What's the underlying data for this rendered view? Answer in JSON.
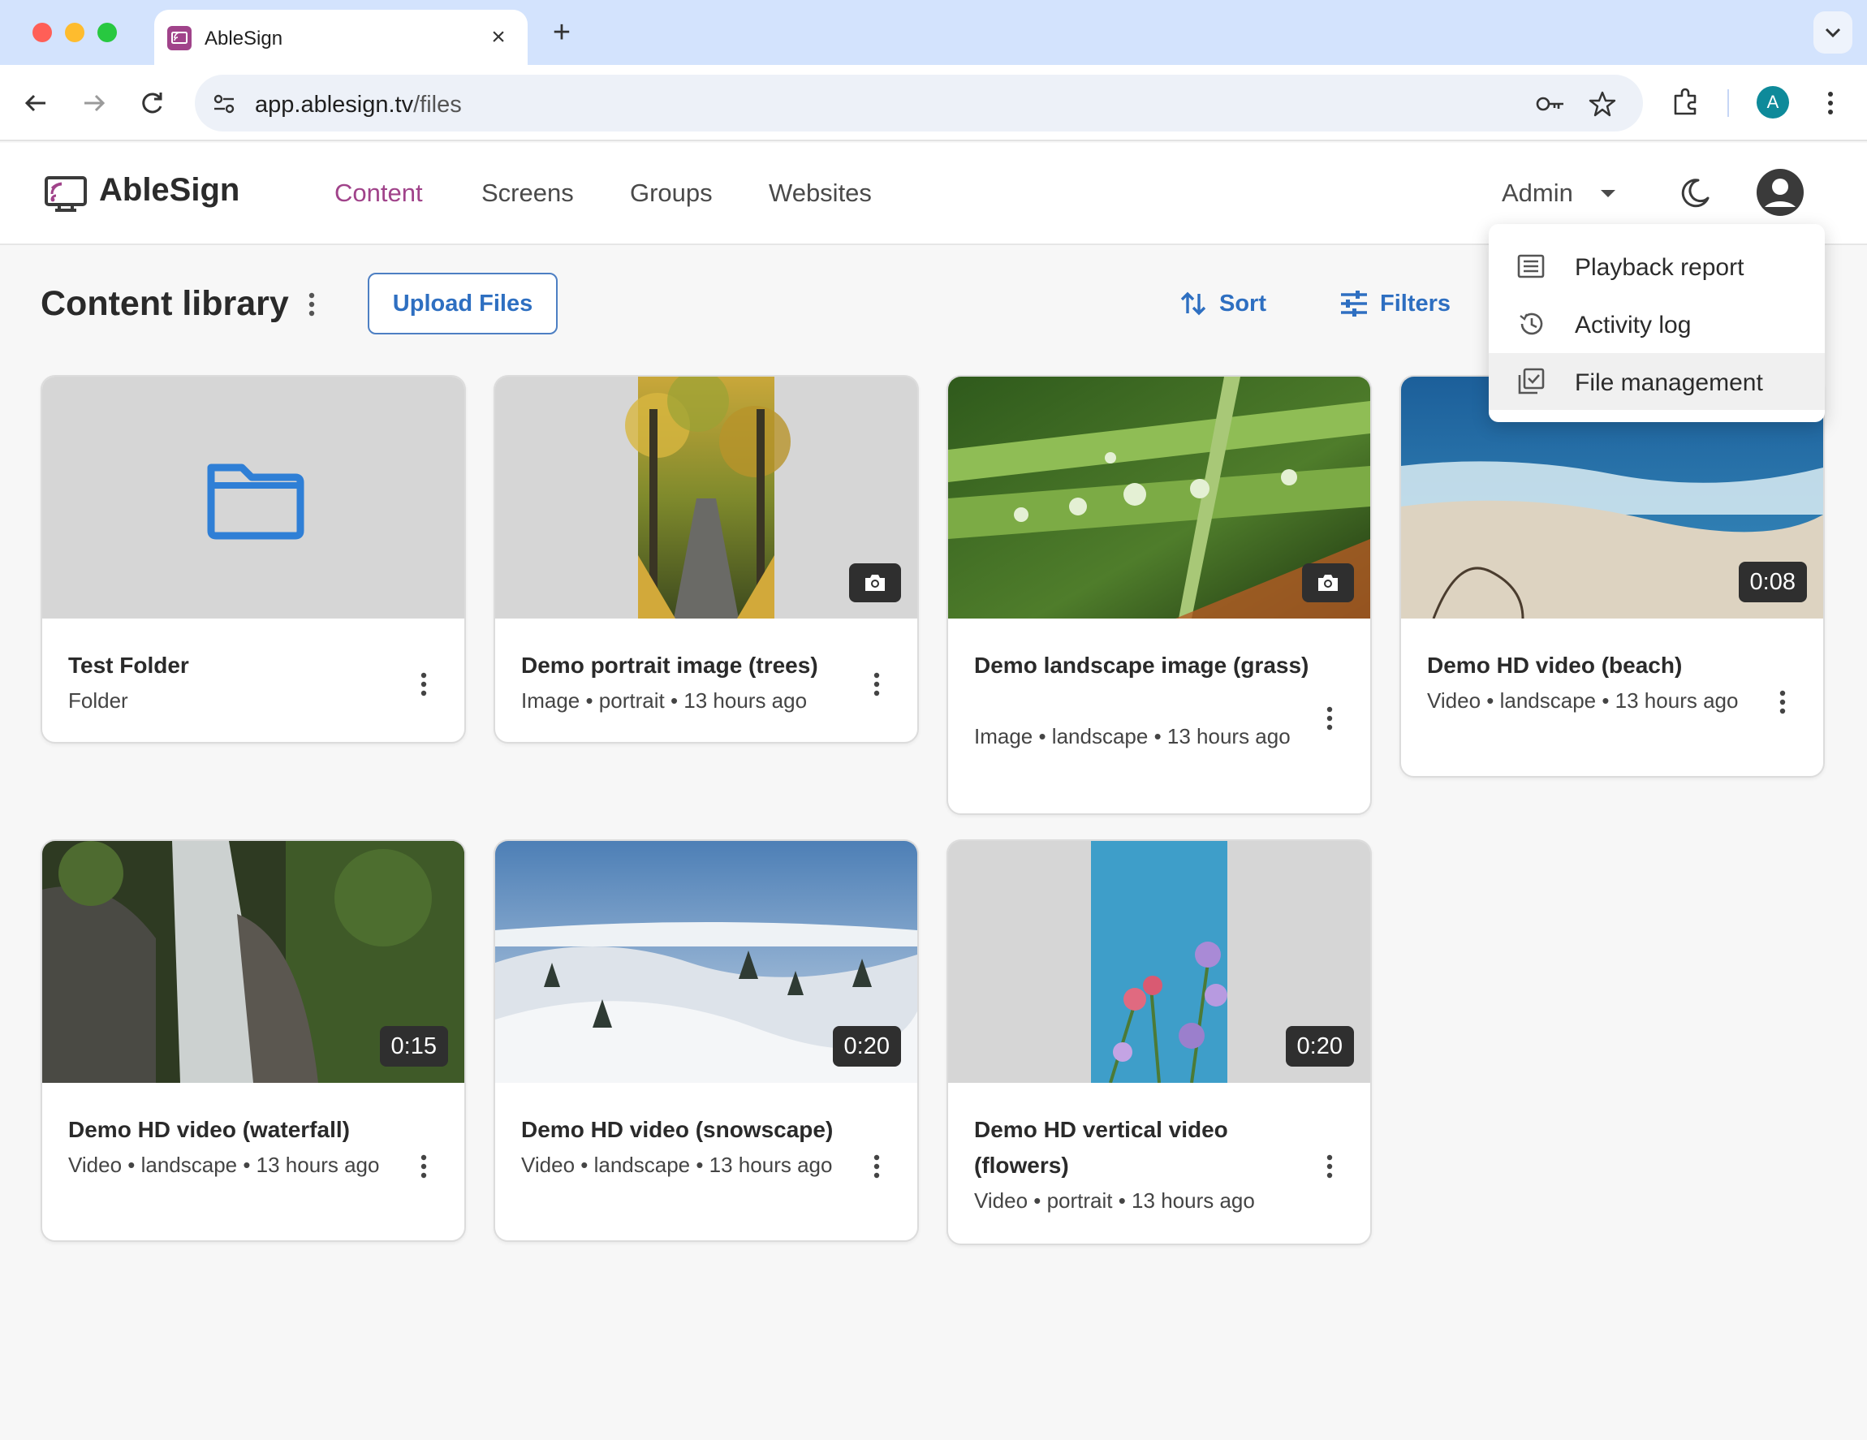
{
  "browser": {
    "tab_title": "AbleSign",
    "tab_close": "×",
    "new_tab": "+",
    "url_host": "app.ablesign.tv",
    "url_path": "/files",
    "profile_initial": "A"
  },
  "header": {
    "logo_text": "AbleSign",
    "nav": [
      "Content",
      "Screens",
      "Groups",
      "Websites"
    ],
    "active_nav": "Content",
    "admin_label": "Admin"
  },
  "toolbar": {
    "title": "Content library",
    "upload_label": "Upload Files",
    "sort_label": "Sort",
    "filters_label": "Filters"
  },
  "dropdown": {
    "items": [
      "Playback report",
      "Activity log",
      "File management"
    ]
  },
  "cards": [
    {
      "title": "Test Folder",
      "meta": "Folder"
    },
    {
      "title": "Demo portrait image (trees)",
      "meta": "Image • portrait • 13 hours ago"
    },
    {
      "title": "Demo landscape image (grass)",
      "meta": "Image • landscape • 13 hours ago"
    },
    {
      "title": "Demo HD video (beach)",
      "meta": "Video • landscape • 13 hours ago",
      "duration": "0:08"
    },
    {
      "title": "Demo HD video (waterfall)",
      "meta": "Video • landscape • 13 hours ago",
      "duration": "0:15"
    },
    {
      "title": "Demo HD video (snowscape)",
      "meta": "Video • landscape • 13 hours ago",
      "duration": "0:20"
    },
    {
      "title": "Demo HD vertical video (flowers)",
      "meta": "Video • portrait • 13 hours ago",
      "duration": "0:20"
    }
  ],
  "colors": {
    "brand": "#a0438a",
    "accent_blue": "#2e6fc1",
    "folder_blue": "#2f7fd6"
  }
}
